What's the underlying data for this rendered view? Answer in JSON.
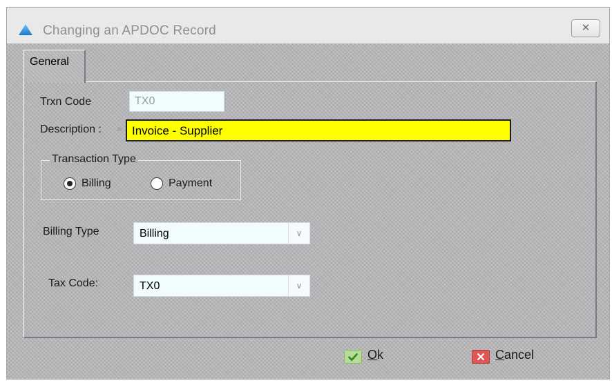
{
  "window": {
    "title": "Changing an APDOC Record",
    "close_symbol": "✕",
    "icon": "app-triangle-icon"
  },
  "tabs": [
    {
      "label": "General",
      "active": true
    }
  ],
  "form": {
    "trxn_code": {
      "label": "Trxn Code",
      "value": "TX0"
    },
    "description": {
      "label": "Description :",
      "value": "Invoice - Supplier",
      "highlight_color": "#ffff00"
    },
    "transaction_type": {
      "legend": "Transaction Type",
      "options": [
        {
          "label": "Billing",
          "checked": true
        },
        {
          "label": "Payment",
          "checked": false
        }
      ]
    },
    "billing_type": {
      "label": "Billing Type",
      "value": "Billing"
    },
    "tax_code": {
      "label": "Tax Code:",
      "value": "TX0"
    }
  },
  "buttons": {
    "ok": {
      "accel": "O",
      "rest": "k",
      "icon": "check-icon"
    },
    "cancel": {
      "accel": "C",
      "rest": "ancel",
      "icon": "x-icon"
    }
  }
}
